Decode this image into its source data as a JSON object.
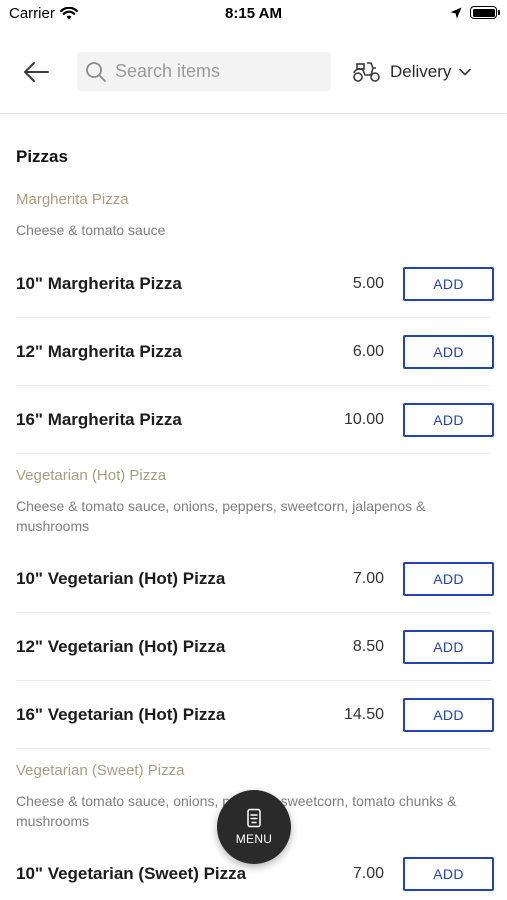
{
  "status_bar": {
    "carrier": "Carrier",
    "time": "8:15 AM"
  },
  "header": {
    "search_placeholder": "Search items",
    "delivery_label": "Delivery"
  },
  "section": {
    "title": "Pizzas"
  },
  "groups": [
    {
      "name": "Margherita Pizza",
      "description": "Cheese & tomato sauce",
      "items": [
        {
          "name": "10\" Margherita Pizza",
          "price": "5.00",
          "button": "ADD"
        },
        {
          "name": "12\" Margherita Pizza",
          "price": "6.00",
          "button": "ADD"
        },
        {
          "name": "16\" Margherita Pizza",
          "price": "10.00",
          "button": "ADD"
        }
      ]
    },
    {
      "name": "Vegetarian (Hot) Pizza",
      "description": "Cheese & tomato sauce, onions, peppers, sweetcorn, jalapenos & mushrooms",
      "items": [
        {
          "name": "10\" Vegetarian (Hot) Pizza",
          "price": "7.00",
          "button": "ADD"
        },
        {
          "name": "12\" Vegetarian (Hot) Pizza",
          "price": "8.50",
          "button": "ADD"
        },
        {
          "name": "16\" Vegetarian (Hot) Pizza",
          "price": "14.50",
          "button": "ADD"
        }
      ]
    },
    {
      "name": "Vegetarian (Sweet) Pizza",
      "description": "Cheese & tomato sauce, onions, peppers, sweetcorn, tomato chunks & mushrooms",
      "items": [
        {
          "name": "10\" Vegetarian (Sweet) Pizza",
          "price": "7.00",
          "button": "ADD"
        }
      ]
    }
  ],
  "menu_button": {
    "label": "MENU"
  },
  "colors": {
    "accent": "#2343b5",
    "group_name": "#a99e7e",
    "fab": "#2a2a2a"
  },
  "icons": [
    "wifi-icon",
    "location-arrow-icon",
    "battery-icon",
    "back-arrow-icon",
    "search-icon",
    "scooter-icon",
    "chevron-down-icon",
    "menu-icon"
  ]
}
